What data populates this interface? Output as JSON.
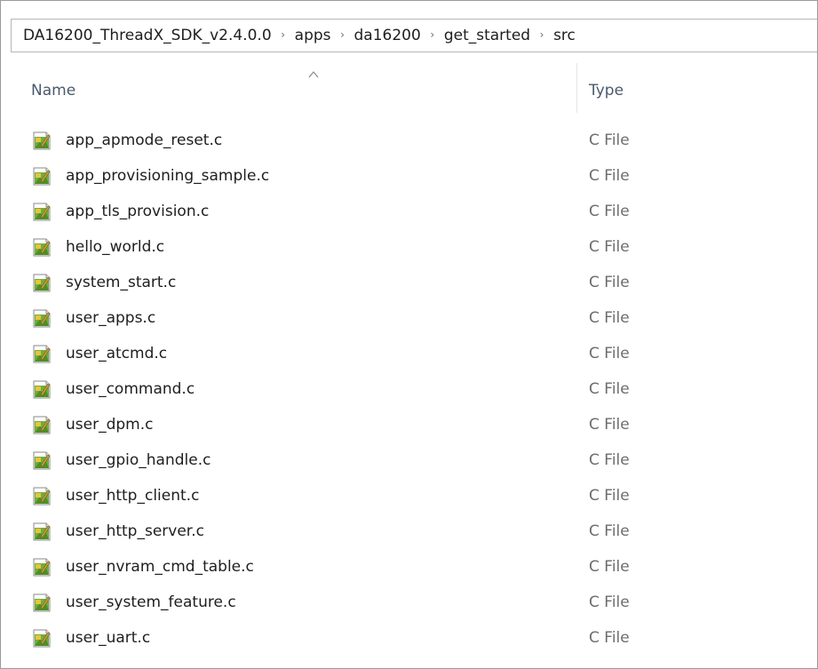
{
  "breadcrumb": [
    "DA16200_ThreadX_SDK_v2.4.0.0",
    "apps",
    "da16200",
    "get_started",
    "src"
  ],
  "breadcrumb_separator": "›",
  "columns": {
    "name": "Name",
    "type": "Type",
    "sorted_by": "Name",
    "sort_icon": "sort-ascending-caret-icon"
  },
  "files": [
    {
      "name": "app_apmode_reset.c",
      "type": "C File",
      "icon": "c-source-file-icon"
    },
    {
      "name": "app_provisioning_sample.c",
      "type": "C File",
      "icon": "c-source-file-icon"
    },
    {
      "name": "app_tls_provision.c",
      "type": "C File",
      "icon": "c-source-file-icon"
    },
    {
      "name": "hello_world.c",
      "type": "C File",
      "icon": "c-source-file-icon"
    },
    {
      "name": "system_start.c",
      "type": "C File",
      "icon": "c-source-file-icon"
    },
    {
      "name": "user_apps.c",
      "type": "C File",
      "icon": "c-source-file-icon"
    },
    {
      "name": "user_atcmd.c",
      "type": "C File",
      "icon": "c-source-file-icon"
    },
    {
      "name": "user_command.c",
      "type": "C File",
      "icon": "c-source-file-icon"
    },
    {
      "name": "user_dpm.c",
      "type": "C File",
      "icon": "c-source-file-icon"
    },
    {
      "name": "user_gpio_handle.c",
      "type": "C File",
      "icon": "c-source-file-icon"
    },
    {
      "name": "user_http_client.c",
      "type": "C File",
      "icon": "c-source-file-icon"
    },
    {
      "name": "user_http_server.c",
      "type": "C File",
      "icon": "c-source-file-icon"
    },
    {
      "name": "user_nvram_cmd_table.c",
      "type": "C File",
      "icon": "c-source-file-icon"
    },
    {
      "name": "user_system_feature.c",
      "type": "C File",
      "icon": "c-source-file-icon"
    },
    {
      "name": "user_uart.c",
      "type": "C File",
      "icon": "c-source-file-icon"
    }
  ],
  "colors": {
    "header_text": "#4a5a6d",
    "type_text": "#6d6d6d",
    "icon_green": "#6fae3c",
    "icon_yellow": "#e8c43c"
  }
}
